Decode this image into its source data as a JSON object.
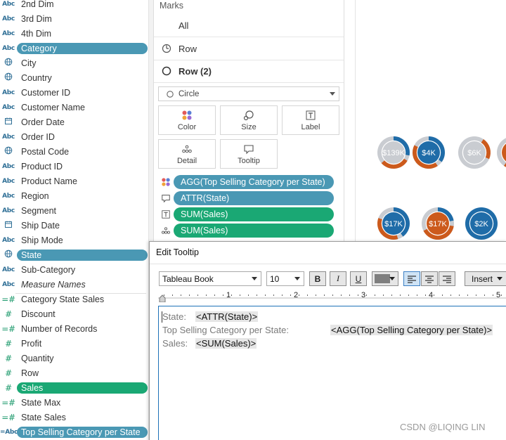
{
  "data_pane": {
    "fields": [
      {
        "type": "Abc",
        "label": "2nd Dim",
        "icon": "abc-icon",
        "state": "normal"
      },
      {
        "type": "Abc",
        "label": "3rd Dim",
        "icon": "abc-icon",
        "state": "normal"
      },
      {
        "type": "Abc",
        "label": "4th Dim",
        "icon": "abc-icon",
        "state": "normal"
      },
      {
        "type": "Abc",
        "label": "Category",
        "icon": "abc-icon",
        "state": "selected-blue"
      },
      {
        "type": "geo",
        "label": "City",
        "icon": "globe-icon",
        "state": "normal"
      },
      {
        "type": "geo",
        "label": "Country",
        "icon": "globe-icon",
        "state": "normal"
      },
      {
        "type": "Abc",
        "label": "Customer ID",
        "icon": "abc-icon",
        "state": "normal"
      },
      {
        "type": "Abc",
        "label": "Customer Name",
        "icon": "abc-icon",
        "state": "normal"
      },
      {
        "type": "date",
        "label": "Order Date",
        "icon": "calendar-icon",
        "state": "normal"
      },
      {
        "type": "Abc",
        "label": "Order ID",
        "icon": "abc-icon",
        "state": "normal"
      },
      {
        "type": "geo",
        "label": "Postal Code",
        "icon": "globe-icon",
        "state": "normal"
      },
      {
        "type": "Abc",
        "label": "Product ID",
        "icon": "abc-icon",
        "state": "normal"
      },
      {
        "type": "Abc",
        "label": "Product Name",
        "icon": "abc-icon",
        "state": "normal"
      },
      {
        "type": "Abc",
        "label": "Region",
        "icon": "abc-icon",
        "state": "normal"
      },
      {
        "type": "Abc",
        "label": "Segment",
        "icon": "abc-icon",
        "state": "normal"
      },
      {
        "type": "date",
        "label": "Ship Date",
        "icon": "calendar-icon",
        "state": "normal"
      },
      {
        "type": "Abc",
        "label": "Ship Mode",
        "icon": "abc-icon",
        "state": "normal"
      },
      {
        "type": "geo",
        "label": "State",
        "icon": "globe-icon",
        "state": "selected-blue"
      },
      {
        "type": "Abc",
        "label": "Sub-Category",
        "icon": "abc-icon",
        "state": "normal"
      },
      {
        "type": "Abc",
        "label": "Measure Names",
        "icon": "abc-icon",
        "state": "italic"
      },
      {
        "type": "calc-measure",
        "label": "Category State Sales",
        "icon": "calc-hash-icon",
        "state": "normal"
      },
      {
        "type": "measure",
        "label": "Discount",
        "icon": "hash-icon",
        "state": "normal"
      },
      {
        "type": "calc-measure",
        "label": "Number of Records",
        "icon": "calc-hash-icon",
        "state": "normal"
      },
      {
        "type": "measure",
        "label": "Profit",
        "icon": "hash-icon",
        "state": "normal"
      },
      {
        "type": "measure",
        "label": "Quantity",
        "icon": "hash-icon",
        "state": "normal"
      },
      {
        "type": "measure",
        "label": "Row",
        "icon": "hash-icon",
        "state": "normal"
      },
      {
        "type": "measure",
        "label": "Sales",
        "icon": "hash-icon",
        "state": "selected-green"
      },
      {
        "type": "calc-measure",
        "label": "State Max",
        "icon": "calc-hash-icon",
        "state": "normal"
      },
      {
        "type": "calc-measure",
        "label": "State Sales",
        "icon": "calc-hash-icon",
        "state": "normal"
      },
      {
        "type": "calc-Abc",
        "label": "Top Selling Category per State",
        "icon": "calc-abc-icon",
        "state": "selected-blue"
      }
    ]
  },
  "marks": {
    "title": "Marks",
    "rows": [
      {
        "label": "All",
        "icon": ""
      },
      {
        "label": "Row",
        "icon": "clock-pie-icon"
      },
      {
        "label": "Row (2)",
        "icon": "circle-outline-icon"
      }
    ],
    "mark_type": {
      "label": "Circle",
      "icon": "circle-outline-icon"
    },
    "buttons": [
      {
        "label": "Color",
        "icon": "color-dots-icon"
      },
      {
        "label": "Size",
        "icon": "size-icon"
      },
      {
        "label": "Label",
        "icon": "label-t-icon"
      },
      {
        "label": "Detail",
        "icon": "detail-dots-icon"
      },
      {
        "label": "Tooltip",
        "icon": "tooltip-bubble-icon"
      }
    ],
    "pills": [
      {
        "label": "AGG(Top Selling Category per State)",
        "icon": "color-dots-icon",
        "color": "blue"
      },
      {
        "label": "ATTR(State)",
        "icon": "tooltip-bubble-icon",
        "color": "blue"
      },
      {
        "label": "SUM(Sales)",
        "icon": "label-t-icon",
        "color": "green"
      },
      {
        "label": "SUM(Sales)",
        "icon": "detail-dots-icon",
        "color": "green"
      }
    ]
  },
  "canvas": {
    "colors": {
      "blue": "#1f6ca8",
      "orange": "#cc5a1c",
      "gray": "#c9ccd1"
    },
    "donuts": [
      {
        "label": "$139K",
        "center": "gray",
        "blue_share": 0.28,
        "orange_share": 0.3
      },
      {
        "label": "$4K",
        "center": "blue",
        "blue_share": 0.35,
        "orange_share": 0.42
      },
      {
        "label": "$6K",
        "center": "gray",
        "blue_share": 0.0,
        "orange_share": 0.22
      },
      {
        "label": "",
        "center": "orange",
        "blue_share": 0.0,
        "orange_share": 0.5
      },
      {
        "label": "$17K",
        "center": "blue",
        "blue_share": 0.4,
        "orange_share": 0.35
      },
      {
        "label": "$17K",
        "center": "orange",
        "blue_share": 0.22,
        "orange_share": 0.4
      },
      {
        "label": "$2K",
        "center": "blue",
        "blue_share": 0.0,
        "orange_share": 0.0
      }
    ]
  },
  "tooltip_dialog": {
    "title": "Edit Tooltip",
    "font_family": "Tableau Book",
    "font_size": "10",
    "bold": "B",
    "italic": "I",
    "underline": "U",
    "text_color": "#7f7f7f",
    "insert_label": "Insert",
    "ruler_marks": [
      "1",
      "2",
      "3",
      "4",
      "5"
    ],
    "lines": [
      {
        "prefix": "State:",
        "field": "<ATTR(State)>"
      },
      {
        "prefix": "Top Selling Category per State:",
        "field": "<AGG(Top Selling Category per State)>"
      },
      {
        "prefix": "Sales:",
        "field": "<SUM(Sales)>"
      }
    ]
  },
  "watermark": "CSDN @LIQING LIN"
}
